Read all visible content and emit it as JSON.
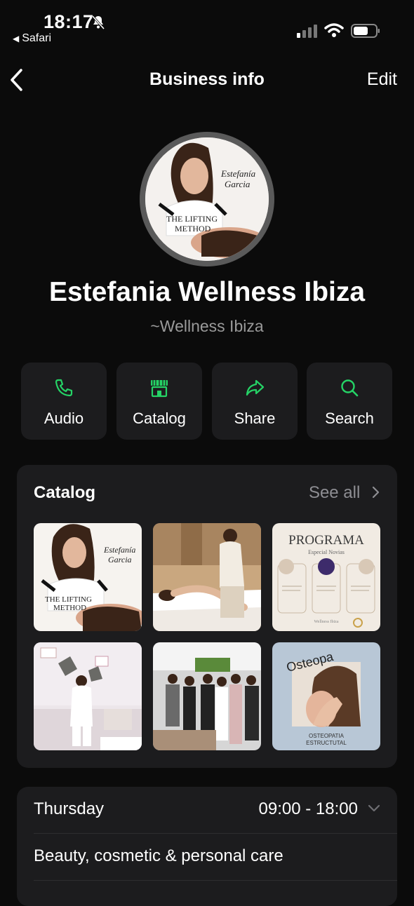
{
  "status_bar": {
    "time": "18:17",
    "back_app": "Safari"
  },
  "nav": {
    "title": "Business info",
    "edit_label": "Edit"
  },
  "profile": {
    "name": "Estefania Wellness Ibiza",
    "subtitle": "~Wellness Ibiza",
    "avatar_text": {
      "signature": "Estefanía\nGarcia",
      "method": "THE LIFTING\nMETHOD"
    }
  },
  "actions": [
    {
      "label": "Audio",
      "icon": "phone-icon"
    },
    {
      "label": "Catalog",
      "icon": "store-icon"
    },
    {
      "label": "Share",
      "icon": "share-icon"
    },
    {
      "label": "Search",
      "icon": "search-icon"
    }
  ],
  "catalog": {
    "title": "Catalog",
    "see_all": "See all",
    "items": [
      {
        "signature": "Estefanía\nGarcia",
        "method": "THE LIFTING\nMETHOD"
      },
      {
        "desc": "massage"
      },
      {
        "title": "PROGRAMA",
        "subtitle": "Especial Novias",
        "footer": "Wellness Ibiza"
      },
      {
        "desc": "clinic"
      },
      {
        "desc": "group"
      },
      {
        "word": "Osteopa",
        "caption": "OSTEOPATIA\nESTRUCTUTAL"
      }
    ]
  },
  "info": {
    "hours_day": "Thursday",
    "hours_time": "09:00 - 18:00",
    "category": "Beauty, cosmetic & personal care"
  },
  "colors": {
    "accent_green": "#25d366",
    "card_bg": "#1c1c1e",
    "page_bg": "#0b0b0b"
  }
}
